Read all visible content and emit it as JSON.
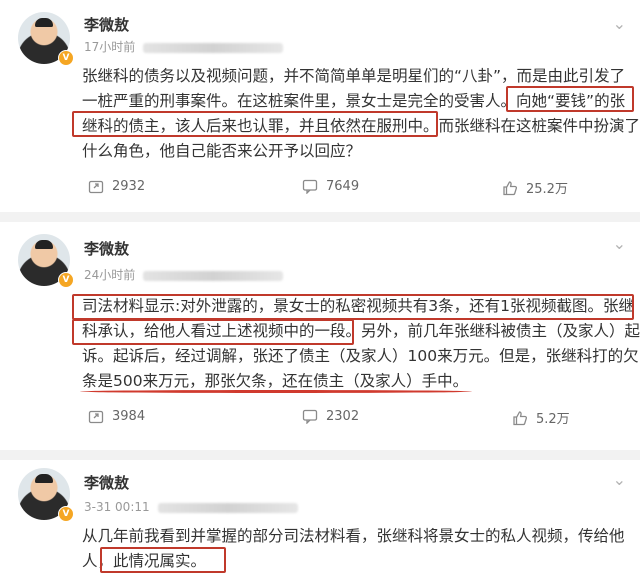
{
  "posts": [
    {
      "author": "李微敖",
      "time": "17小时前",
      "lines": [
        "张继科的债务以及视频问题，并不简简单单是明星们的“八卦”，而是由此引发了",
        "一桩严重的刑事案件。在这桩案件里，景女士是完全的受害人。向她“要钱”的张",
        "继科的债主，该人后来也认罪，并且依然在服刑中。而张继科在这桩案件中扮演了",
        "什么角色，他自己能否来公开予以回应？"
      ],
      "repost": "2932",
      "comments": "7649",
      "likes": "25.2万"
    },
    {
      "author": "李微敖",
      "time": "24小时前",
      "lines": [
        "司法材料显示:对外泄露的，景女士的私密视频共有3条，还有1张视频截图。张继",
        "科承认，给他人看过上述视频中的一段。另外，前几年张继科被债主（及家人）起",
        "诉。起诉后，经过调解，张还了债主（及家人）100来万元。但是，张继科打的欠",
        "条是500来万元，那张欠条，还在债主（及家人）手中。"
      ],
      "repost": "3984",
      "comments": "2302",
      "likes": "5.2万"
    },
    {
      "author": "李微敖",
      "time": "3-31 00:11",
      "lines": [
        "从几年前我看到并掌握的部分司法材料看，张继科将景女士的私人视频，传给他",
        "人，此情况属实。"
      ]
    }
  ],
  "colors": {
    "highlight": "#c0392b",
    "badge": "#f5a623"
  },
  "icons": [
    "repost-icon",
    "comment-icon",
    "like-icon",
    "chevron-down-icon",
    "verified-badge-icon"
  ]
}
